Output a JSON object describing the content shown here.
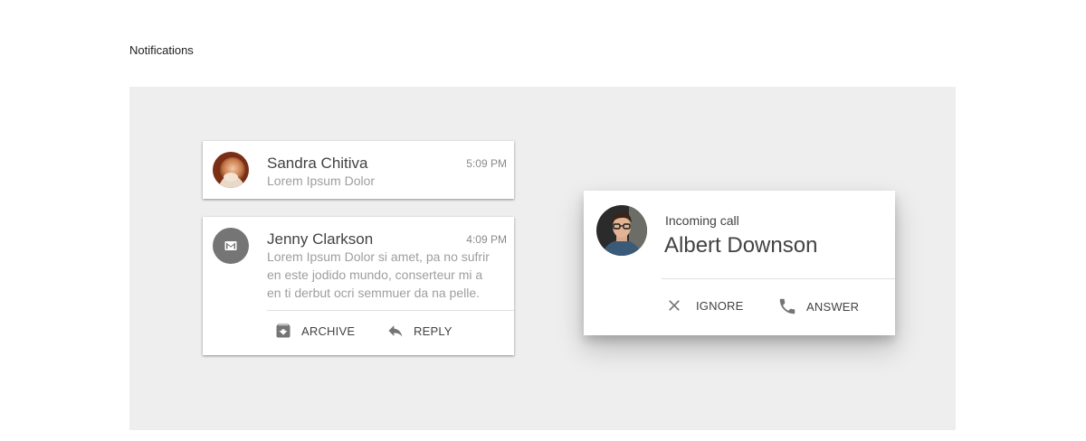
{
  "page": {
    "section_title": "Notifications"
  },
  "notifications": [
    {
      "sender": "Sandra Chitiva",
      "time": "5:09 PM",
      "preview": "Lorem Ipsum Dolor"
    },
    {
      "sender": "Jenny Clarkson",
      "time": "4:09 PM",
      "preview_lines": [
        "Lorem Ipsum Dolor si amet, pa no sufrir",
        "en este jodido mundo, conserteur mi a",
        "en ti derbut ocri semmuer da na pelle."
      ],
      "actions": {
        "archive": "ARCHIVE",
        "reply": "REPLY"
      }
    }
  ],
  "incoming_call": {
    "label": "Incoming call",
    "caller": "Albert Downson",
    "actions": {
      "ignore": "IGNORE",
      "answer": "ANSWER"
    }
  },
  "colors": {
    "stage_background": "#eeeeee",
    "card_background": "#ffffff",
    "icon_gray": "#757575",
    "gmail_avatar": "#757575"
  },
  "icons": {
    "archive": "archive-icon",
    "reply": "reply-icon",
    "ignore": "close-icon",
    "answer": "phone-icon",
    "gmail": "gmail-icon"
  }
}
